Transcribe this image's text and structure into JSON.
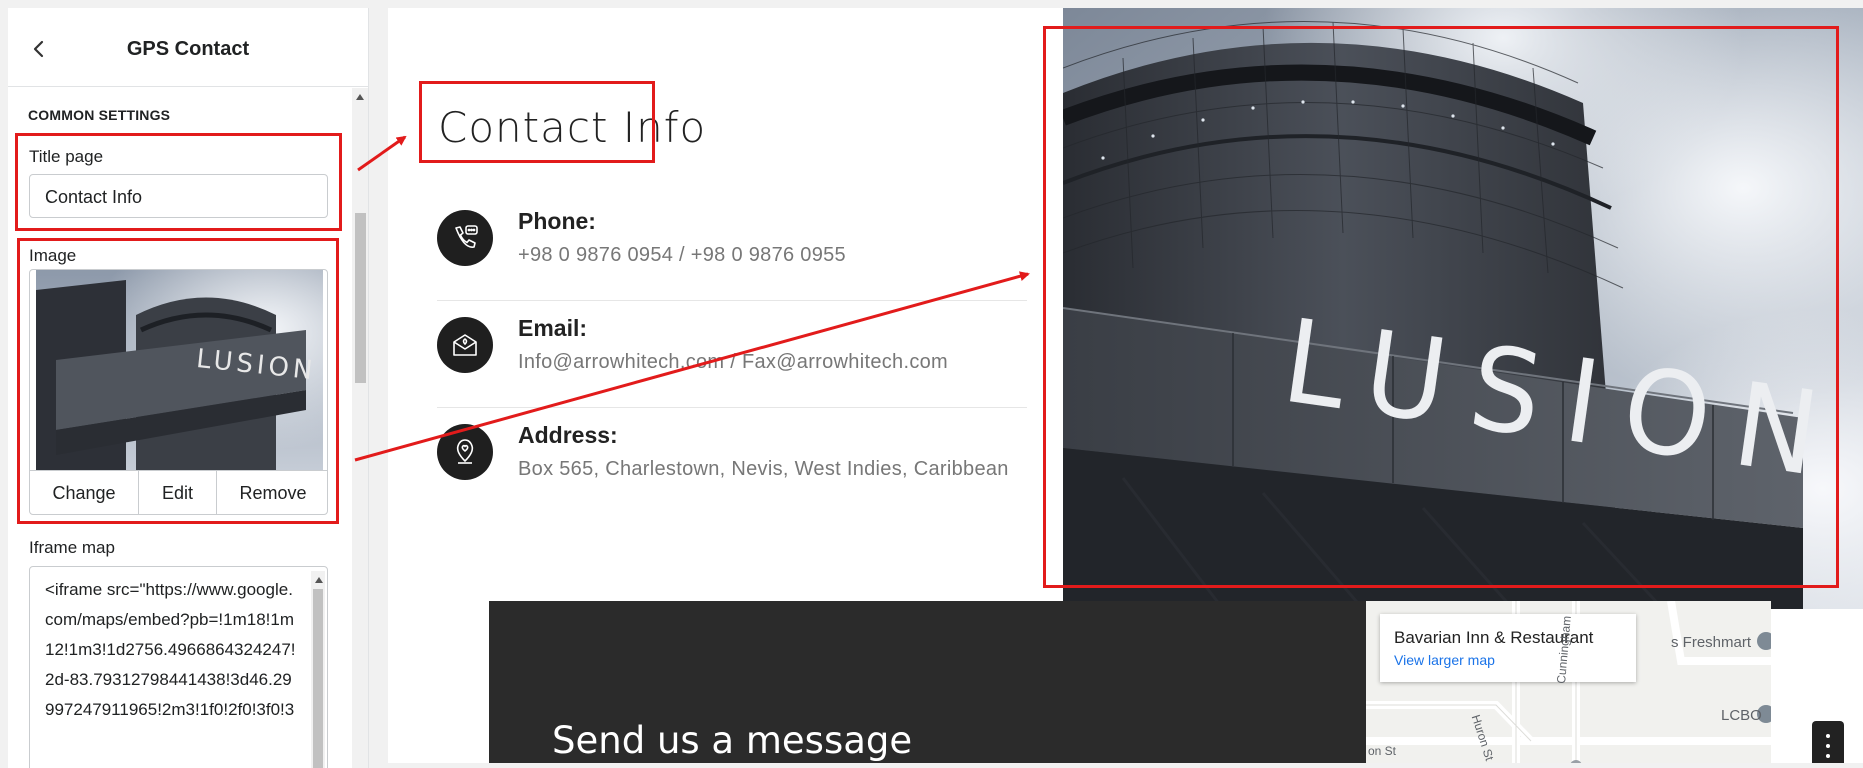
{
  "panel": {
    "title": "GPS Contact",
    "section": "COMMON SETTINGS",
    "title_page_label": "Title page",
    "title_page_value": "Contact Info",
    "image_label": "Image",
    "image_actions": [
      "Change",
      "Edit",
      "Remove"
    ],
    "iframe_label": "Iframe map",
    "iframe_value": "<iframe src=\"https://www.google.com/maps/embed?pb=!1m18!1m12!1m3!1d2756.4966864324247!2d-83.79312798441438!3d46.29997247911965!2m3!1f0!2f0!3f0!3"
  },
  "preview": {
    "title": "Contact Info",
    "items": [
      {
        "heading": "Phone:",
        "text": "+98 0 9876 0954 / +98 0 9876 0955",
        "icon": "phone-icon"
      },
      {
        "heading": "Email:",
        "text": "Info@arrowhitech.com / Fax@arrowhitech.com",
        "icon": "mail-icon"
      },
      {
        "heading": "Address:",
        "text": "Box 565, Charlestown, Nevis, West Indies, Caribbean",
        "icon": "location-icon"
      }
    ],
    "hero_sign": "LUSION",
    "send_title": "Send us a message",
    "map": {
      "place": "Bavarian Inn & Restaurant",
      "link": "View larger map",
      "labels": [
        "s Freshmart",
        "LCBO",
        "on St",
        "Huron St",
        "Cunningham"
      ]
    }
  },
  "colors": {
    "annotation": "#e21b1b",
    "dark_band": "#2b2b2b",
    "link": "#1a73e8"
  }
}
